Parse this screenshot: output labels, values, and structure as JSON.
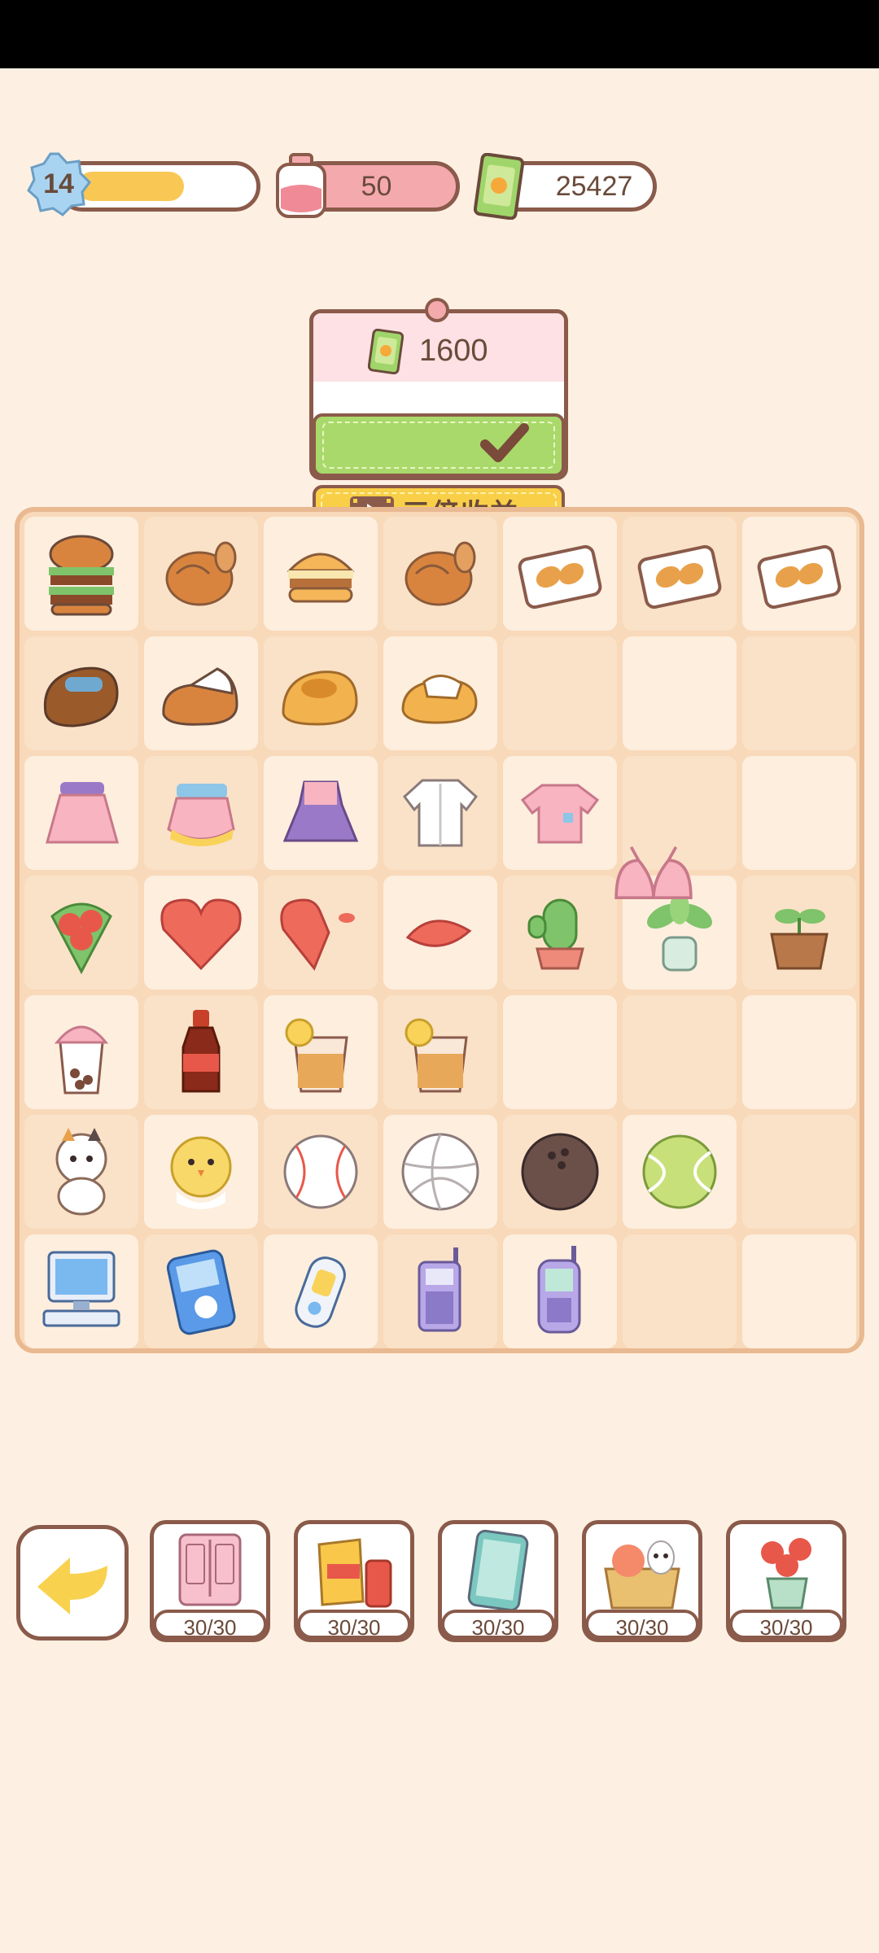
{
  "hud": {
    "level": "14",
    "level_progress": 0.58,
    "energy": "50",
    "cash": "25427"
  },
  "popup": {
    "price": "1600",
    "collect_icon": "checkmark-icon",
    "triple_label": "三倍收益",
    "triple_icon": "video-icon"
  },
  "board": {
    "columns": 7,
    "rows": 7,
    "items": [
      [
        "burger-big",
        "roast-chicken",
        "burger-small",
        "roast-chicken",
        "pastry-box",
        "pastry-box",
        "pastry-box"
      ],
      [
        "sandal-brown",
        "sneaker",
        "clog-yellow",
        "slipper",
        "",
        "",
        ""
      ],
      [
        "skirt-pink",
        "skirt-yellow",
        "dress-purple",
        "shirt-white",
        "tshirt-pink",
        "",
        ""
      ],
      [
        "rose-bouquet",
        "rose-heart",
        "rose-half-heart",
        "rose-petal",
        "cactus-pot",
        "potted-plant",
        "sprout-pot"
      ],
      [
        "milk-tea",
        "cola-bottle",
        "lemon-tea",
        "lemon-tea",
        "",
        "",
        ""
      ],
      [
        "cat-plush",
        "chick-plush",
        "baseball",
        "volleyball",
        "bowling-ball",
        "tennis-ball",
        ""
      ],
      [
        "desktop-computer",
        "mp3-player",
        "mp3-player-small",
        "brick-phone",
        "flip-phone",
        "",
        ""
      ]
    ],
    "floating_item": "bra-pink"
  },
  "bottom_bar": {
    "back_icon": "back-arrow-icon",
    "boxes": [
      {
        "icon": "wardrobe-icon",
        "count": "30/30"
      },
      {
        "icon": "snacks-icon",
        "count": "30/30"
      },
      {
        "icon": "phone-icon",
        "count": "30/30"
      },
      {
        "icon": "food-box-icon",
        "count": "30/30"
      },
      {
        "icon": "flower-vase-icon",
        "count": "30/30"
      }
    ]
  },
  "colors": {
    "background": "#fdf0e2",
    "outline": "#8a5a4a",
    "board": "#f8d9ba",
    "collect_green": "#a9d96a",
    "triple_yellow": "#f9cf48",
    "level_fill": "#f9c754",
    "energy_fill": "#f4a9ad"
  }
}
